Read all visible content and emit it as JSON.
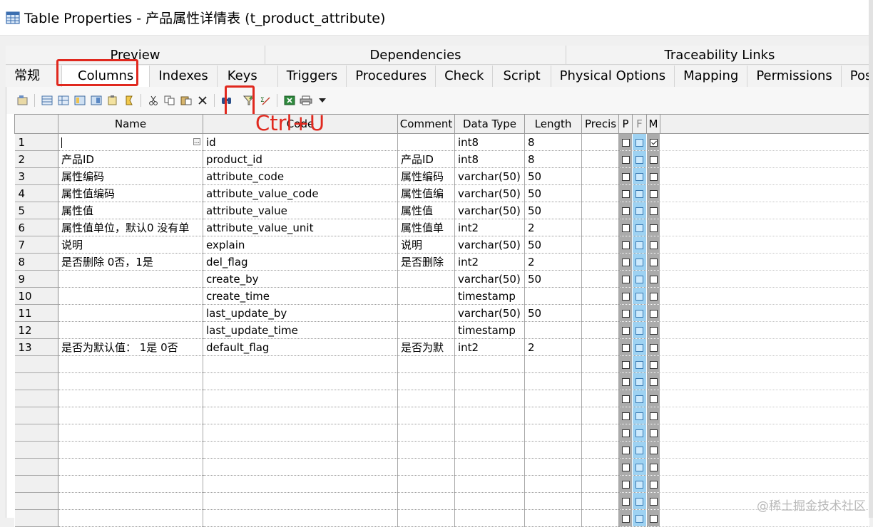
{
  "window": {
    "title": "Table Properties - 产品属性详情表 (t_product_attribute)"
  },
  "tabs_top": [
    "Preview",
    "Dependencies",
    "Traceability Links"
  ],
  "tabs": [
    "常规",
    "Columns",
    "Indexes",
    "Keys",
    "Triggers",
    "Procedures",
    "Check",
    "Script",
    "Physical Options",
    "Mapping",
    "Permissions",
    "Postgr"
  ],
  "active_tab": "Columns",
  "annotation": {
    "text": "Ctrl+U",
    "color": "#e0281e"
  },
  "toolbar": {
    "icons": [
      "properties-icon",
      "insert-row-icon",
      "add-row-icon",
      "add-columns-icon",
      "replace-columns-icon",
      "paste-icon",
      "domain-icon",
      "cut-icon",
      "copy-icon",
      "paste-icon",
      "delete-icon",
      "find-icon",
      "customize-columns-filter-icon",
      "edit-icon",
      "excel-export-icon",
      "print-icon",
      "dropdown-arrow-icon"
    ]
  },
  "grid": {
    "headers": [
      "",
      "Name",
      "Code",
      "Comment",
      "Data Type",
      "Length",
      "Precis",
      "P",
      "F",
      "M"
    ],
    "rows": [
      {
        "num": "1",
        "name": "",
        "code": "id",
        "comment": "",
        "data_type": "int8",
        "length": "8",
        "p": false,
        "f": false,
        "m": true
      },
      {
        "num": "2",
        "name": "产品ID",
        "code": "product_id",
        "comment": "产品ID",
        "data_type": "int8",
        "length": "8",
        "p": false,
        "f": false,
        "m": false
      },
      {
        "num": "3",
        "name": "属性编码",
        "code": "attribute_code",
        "comment": "属性编码",
        "data_type": "varchar(50)",
        "length": "50",
        "p": false,
        "f": false,
        "m": false
      },
      {
        "num": "4",
        "name": "属性值编码",
        "code": "attribute_value_code",
        "comment": "属性值编",
        "data_type": "varchar(50)",
        "length": "50",
        "p": false,
        "f": false,
        "m": false
      },
      {
        "num": "5",
        "name": "属性值",
        "code": "attribute_value",
        "comment": "属性值",
        "data_type": "varchar(50)",
        "length": "50",
        "p": false,
        "f": false,
        "m": false
      },
      {
        "num": "6",
        "name": "属性值单位，默认0 没有单",
        "code": "attribute_value_unit",
        "comment": "属性值单",
        "data_type": "int2",
        "length": "2",
        "p": false,
        "f": false,
        "m": false
      },
      {
        "num": "7",
        "name": "说明",
        "code": "explain",
        "comment": "说明",
        "data_type": "varchar(50)",
        "length": "50",
        "p": false,
        "f": false,
        "m": false
      },
      {
        "num": "8",
        "name": "是否删除 0否，1是",
        "code": "del_flag",
        "comment": "是否删除",
        "data_type": "int2",
        "length": "2",
        "p": false,
        "f": false,
        "m": false
      },
      {
        "num": "9",
        "name": "",
        "code": "create_by",
        "comment": "",
        "data_type": "varchar(50)",
        "length": "50",
        "p": false,
        "f": false,
        "m": false
      },
      {
        "num": "10",
        "name": "",
        "code": "create_time",
        "comment": "",
        "data_type": "timestamp",
        "length": "",
        "p": false,
        "f": false,
        "m": false
      },
      {
        "num": "11",
        "name": "",
        "code": "last_update_by",
        "comment": "",
        "data_type": "varchar(50)",
        "length": "50",
        "p": false,
        "f": false,
        "m": false
      },
      {
        "num": "12",
        "name": "",
        "code": "last_update_time",
        "comment": "",
        "data_type": "timestamp",
        "length": "",
        "p": false,
        "f": false,
        "m": false
      },
      {
        "num": "13",
        "name": "是否为默认值： 1是 0否",
        "code": "default_flag",
        "comment": "是否为默",
        "data_type": "int2",
        "length": "2",
        "p": false,
        "f": false,
        "m": false
      }
    ],
    "empty_rows": 10
  },
  "watermark": "@稀土掘金技术社区"
}
